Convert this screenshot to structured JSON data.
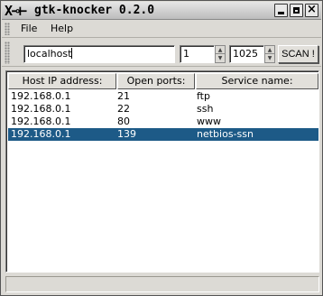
{
  "window": {
    "title": "gtk-knocker 0.2.0",
    "logo_text": "X⊸⊢"
  },
  "menu": {
    "items": [
      {
        "label": "File"
      },
      {
        "label": "Help"
      }
    ]
  },
  "toolbar": {
    "host_value": "localhost",
    "port_start": "1",
    "port_end": "1025",
    "scan_label": "SCAN !"
  },
  "table": {
    "columns": [
      "Host IP address:",
      "Open ports:",
      "Service name:"
    ],
    "rows": [
      {
        "host": "192.168.0.1",
        "port": "21",
        "service": "ftp",
        "selected": false
      },
      {
        "host": "192.168.0.1",
        "port": "22",
        "service": "ssh",
        "selected": false
      },
      {
        "host": "192.168.0.1",
        "port": "80",
        "service": "www",
        "selected": false
      },
      {
        "host": "192.168.0.1",
        "port": "139",
        "service": "netbios-ssn",
        "selected": true
      }
    ]
  },
  "colors": {
    "selection": "#1d5a87",
    "window_bg": "#dcdad5"
  }
}
